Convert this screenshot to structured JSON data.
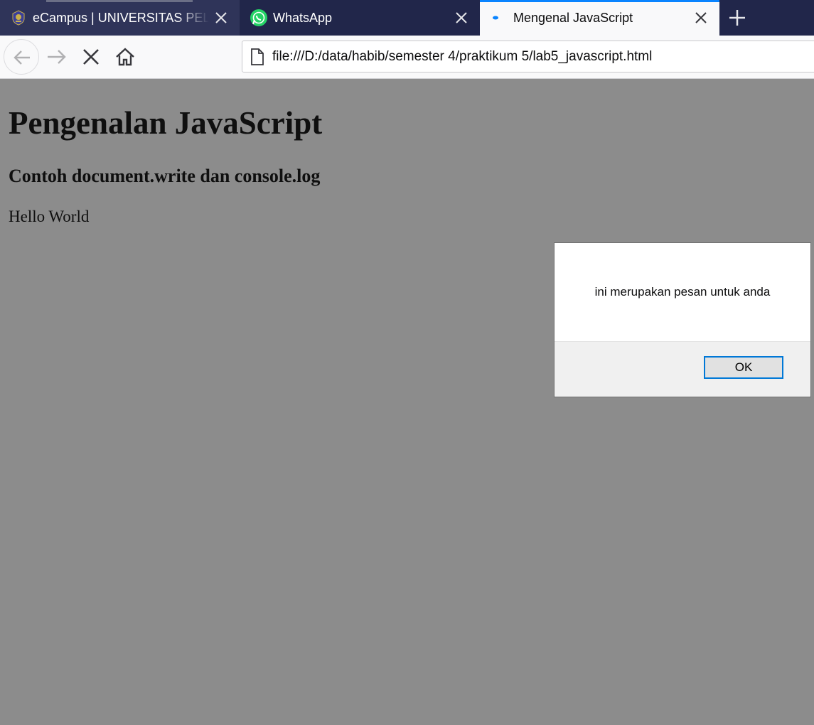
{
  "browser": {
    "tabs": [
      {
        "title": "eCampus | UNIVERSITAS PELITA",
        "favicon": "university-crest-icon",
        "active": false
      },
      {
        "title": "WhatsApp",
        "favicon": "whatsapp-icon",
        "active": false
      },
      {
        "title": "Mengenal JavaScript",
        "favicon": "loading-dot-icon",
        "active": true
      }
    ],
    "address": "file:///D:/data/habib/semester 4/praktikum 5/lab5_javascript.html",
    "accent_color": "#0a84ff"
  },
  "page": {
    "heading": "Pengenalan JavaScript",
    "subheading": "Contoh document.write dan console.log",
    "body_text": "Hello World"
  },
  "alert": {
    "message": "ini merupakan pesan untuk anda",
    "ok_label": "OK"
  }
}
